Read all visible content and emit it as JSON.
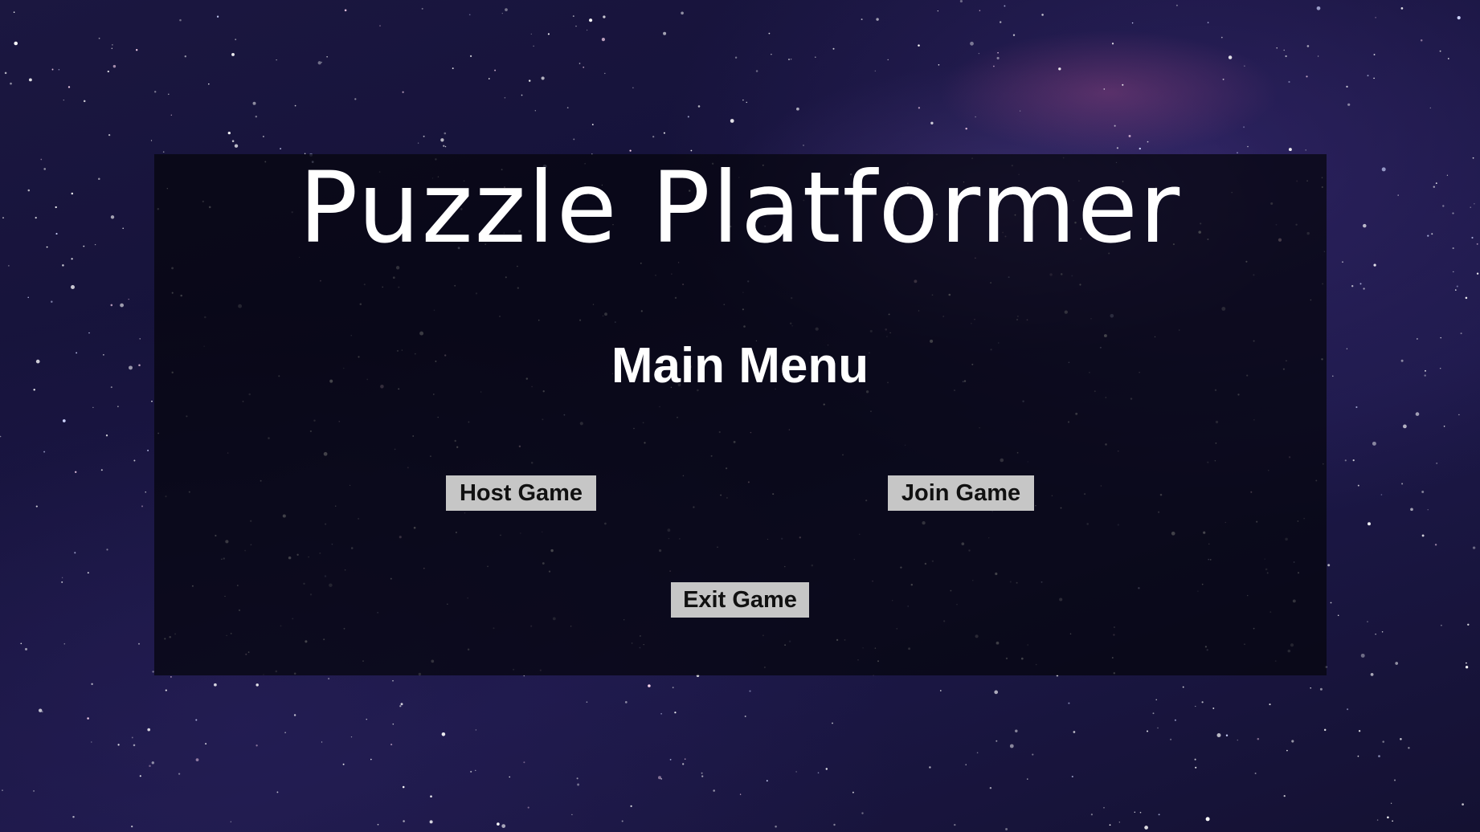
{
  "game": {
    "title": "Puzzle Platformer"
  },
  "main_menu": {
    "heading": "Main Menu",
    "buttons": {
      "host": "Host Game",
      "join": "Join Game",
      "exit": "Exit Game"
    }
  },
  "colors": {
    "button_background": "#c6c6c6",
    "button_text": "#111111",
    "title_text": "#ffffff",
    "panel_overlay": "rgba(6, 5, 14, 0.74)"
  }
}
